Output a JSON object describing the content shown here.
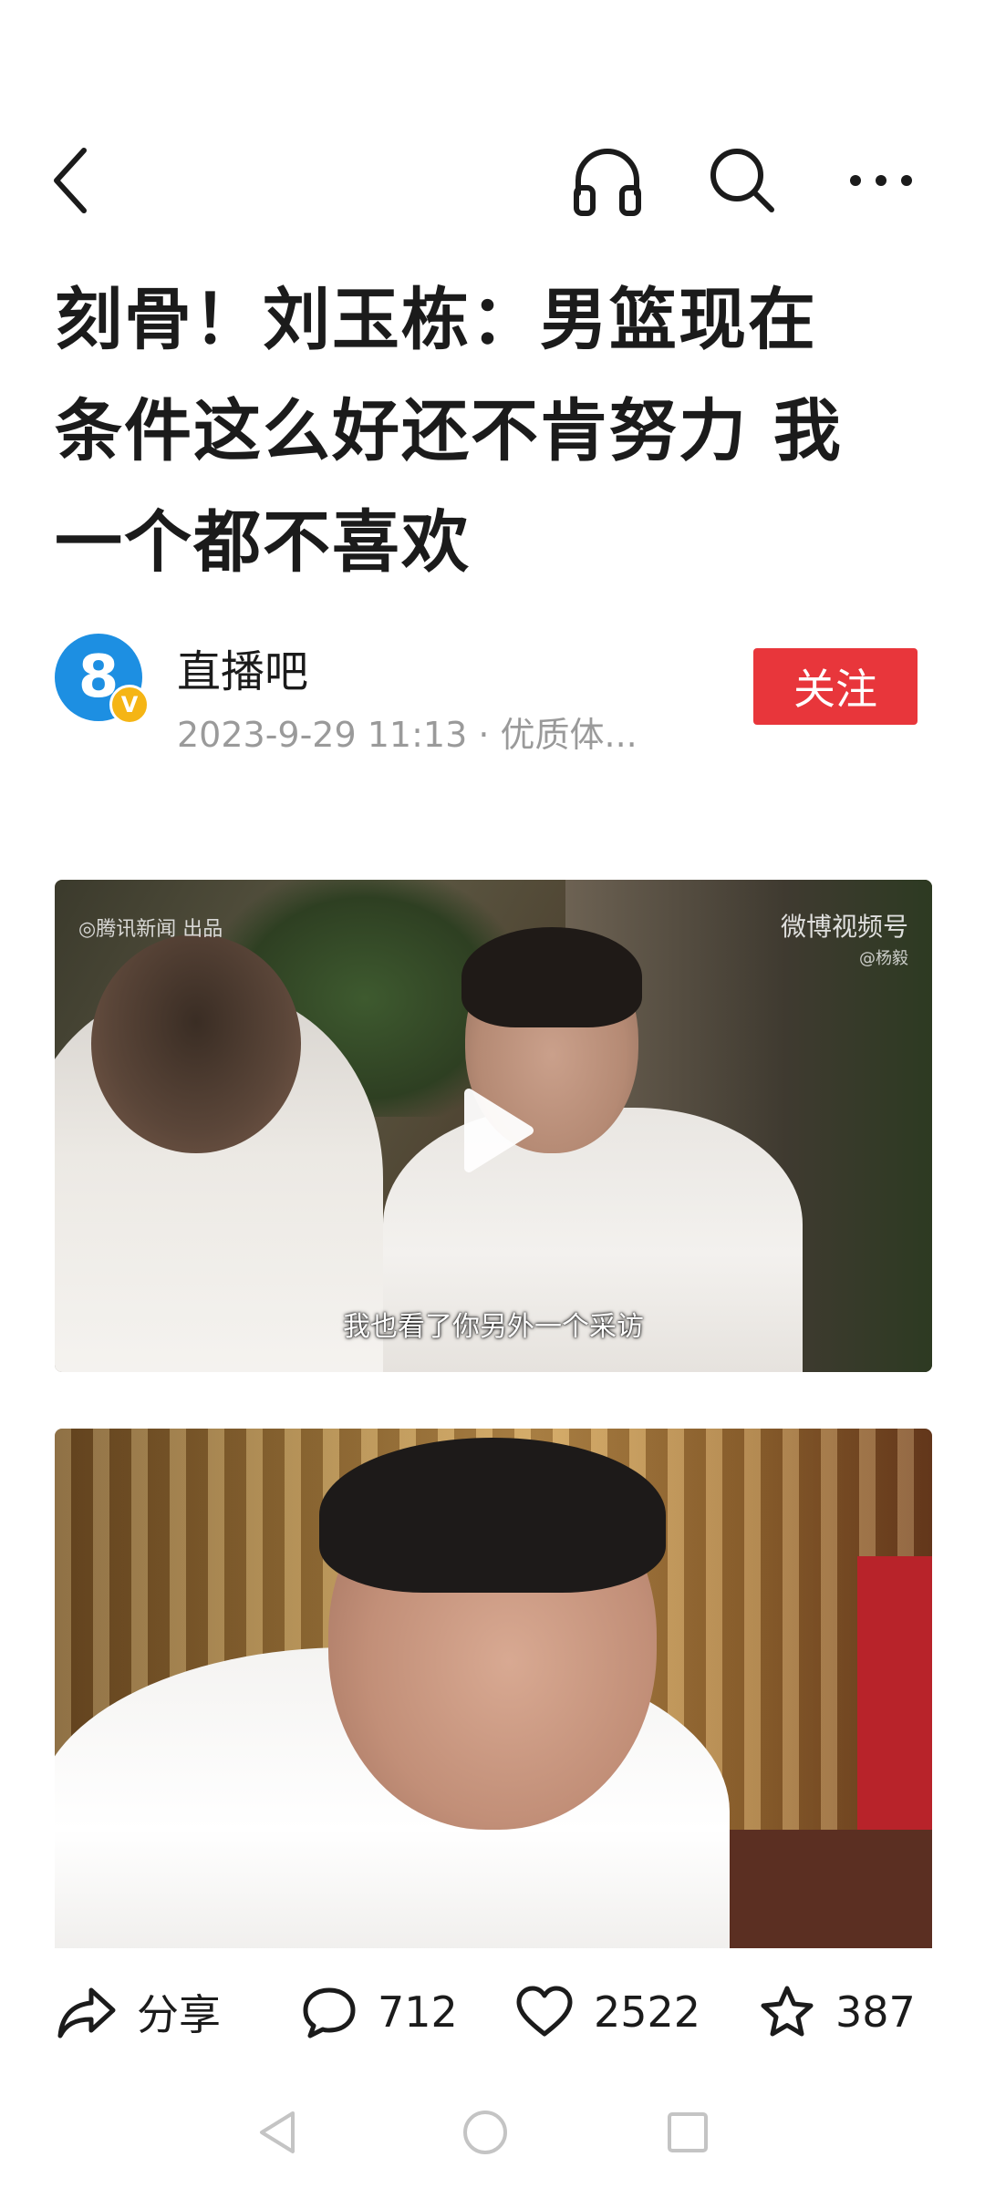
{
  "topbar": {
    "back_icon": "chevron-left-icon",
    "listen_icon": "headphones-icon",
    "search_icon": "search-icon",
    "more_icon": "more-horizontal-icon"
  },
  "article": {
    "title_line1": "刻骨！刘玉栋：男篮现在",
    "title_line2": "条件这么好还不肯努力 我",
    "title_line3": "一个都不喜欢"
  },
  "author": {
    "avatar_text": "8",
    "verified_badge": "V",
    "name": "直播吧",
    "meta": "2023-9-29 11:13 · 优质体...",
    "follow_label": "关注"
  },
  "video": {
    "watermark_left": "◎腾讯新闻 出品",
    "watermark_right": "微博视频号",
    "watermark_right_sub": "@杨毅",
    "subtitle": "我也看了你另外一个采访",
    "play_icon": "play-icon"
  },
  "actions": {
    "share_label": "分享",
    "comment_count": "712",
    "like_count": "2522",
    "favorite_count": "387"
  },
  "colors": {
    "accent_red": "#e8363b",
    "meta_gray": "#9a9a9a",
    "avatar_blue": "#1d8fe2"
  }
}
